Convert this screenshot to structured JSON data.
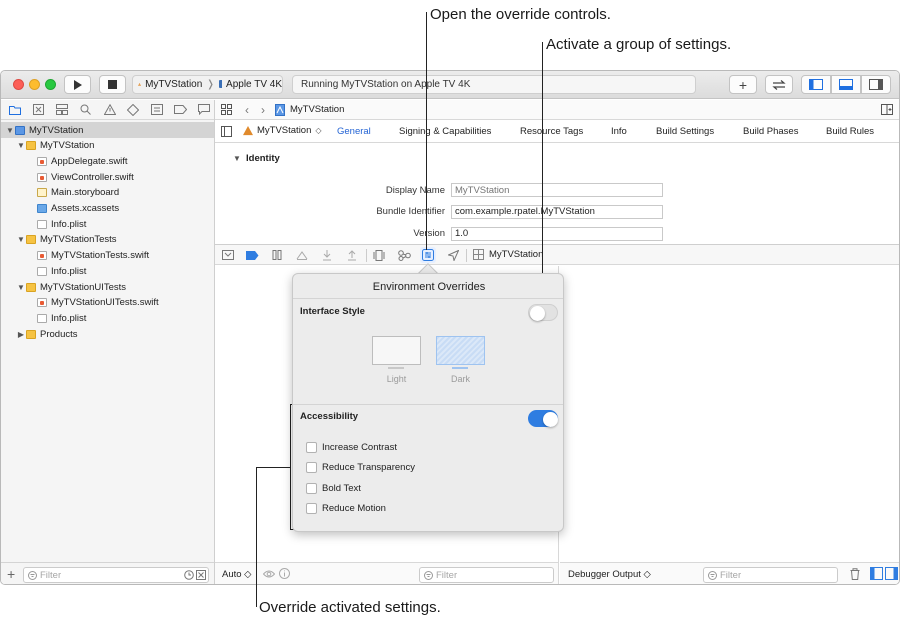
{
  "callouts": {
    "override_controls": "Open the override controls.",
    "group_settings": "Activate a group of settings.",
    "activated_settings": "Override activated settings."
  },
  "toolbar": {
    "scheme_app": "MyTVStation",
    "scheme_device": "Apple TV 4K",
    "activity": "Running MyTVStation on Apple TV 4K",
    "add_label": "+"
  },
  "navigator": {
    "rows": [
      {
        "label": "MyTVStation",
        "indent": 0,
        "icon": "project",
        "disclosure": "open",
        "selected": true
      },
      {
        "label": "MyTVStation",
        "indent": 1,
        "icon": "folder",
        "disclosure": "open"
      },
      {
        "label": "AppDelegate.swift",
        "indent": 2,
        "icon": "swift"
      },
      {
        "label": "ViewController.swift",
        "indent": 2,
        "icon": "swift"
      },
      {
        "label": "Main.storyboard",
        "indent": 2,
        "icon": "storyboard"
      },
      {
        "label": "Assets.xcassets",
        "indent": 2,
        "icon": "folder-blue"
      },
      {
        "label": "Info.plist",
        "indent": 2,
        "icon": "plist"
      },
      {
        "label": "MyTVStationTests",
        "indent": 1,
        "icon": "folder",
        "disclosure": "open"
      },
      {
        "label": "MyTVStationTests.swift",
        "indent": 2,
        "icon": "swift"
      },
      {
        "label": "Info.plist",
        "indent": 2,
        "icon": "plist"
      },
      {
        "label": "MyTVStationUITests",
        "indent": 1,
        "icon": "folder",
        "disclosure": "open"
      },
      {
        "label": "MyTVStationUITests.swift",
        "indent": 2,
        "icon": "swift"
      },
      {
        "label": "Info.plist",
        "indent": 2,
        "icon": "plist"
      },
      {
        "label": "Products",
        "indent": 1,
        "icon": "folder",
        "disclosure": "closed"
      }
    ],
    "filter_placeholder": "Filter"
  },
  "editor": {
    "breadcrumb": "MyTVStation",
    "target": "MyTVStation",
    "tabs": [
      "General",
      "Signing & Capabilities",
      "Resource Tags",
      "Info",
      "Build Settings",
      "Build Phases",
      "Build Rules"
    ],
    "active_tab": "General",
    "section": "Identity",
    "fields": [
      {
        "label": "Display Name",
        "value": "",
        "placeholder": "MyTVStation"
      },
      {
        "label": "Bundle Identifier",
        "value": "com.example.rpatel.MyTVStation",
        "placeholder": ""
      },
      {
        "label": "Version",
        "value": "1.0",
        "placeholder": ""
      }
    ]
  },
  "debugbar": {
    "process": "MyTVStation"
  },
  "popover": {
    "title": "Environment Overrides",
    "interface_style": {
      "label": "Interface Style",
      "enabled": false,
      "options": [
        "Light",
        "Dark"
      ],
      "selected": "Dark"
    },
    "accessibility": {
      "label": "Accessibility",
      "enabled": true,
      "options": [
        {
          "label": "Increase Contrast",
          "checked": false
        },
        {
          "label": "Reduce Transparency",
          "checked": false
        },
        {
          "label": "Bold Text",
          "checked": false
        },
        {
          "label": "Reduce Motion",
          "checked": false
        }
      ]
    }
  },
  "console": {
    "auto_label": "Auto ◇",
    "filter_placeholder": "Filter",
    "output_label": "Debugger Output ◇"
  },
  "colors": {
    "accent": "#2f7de1",
    "toggle_off": "#e2e2e2"
  }
}
